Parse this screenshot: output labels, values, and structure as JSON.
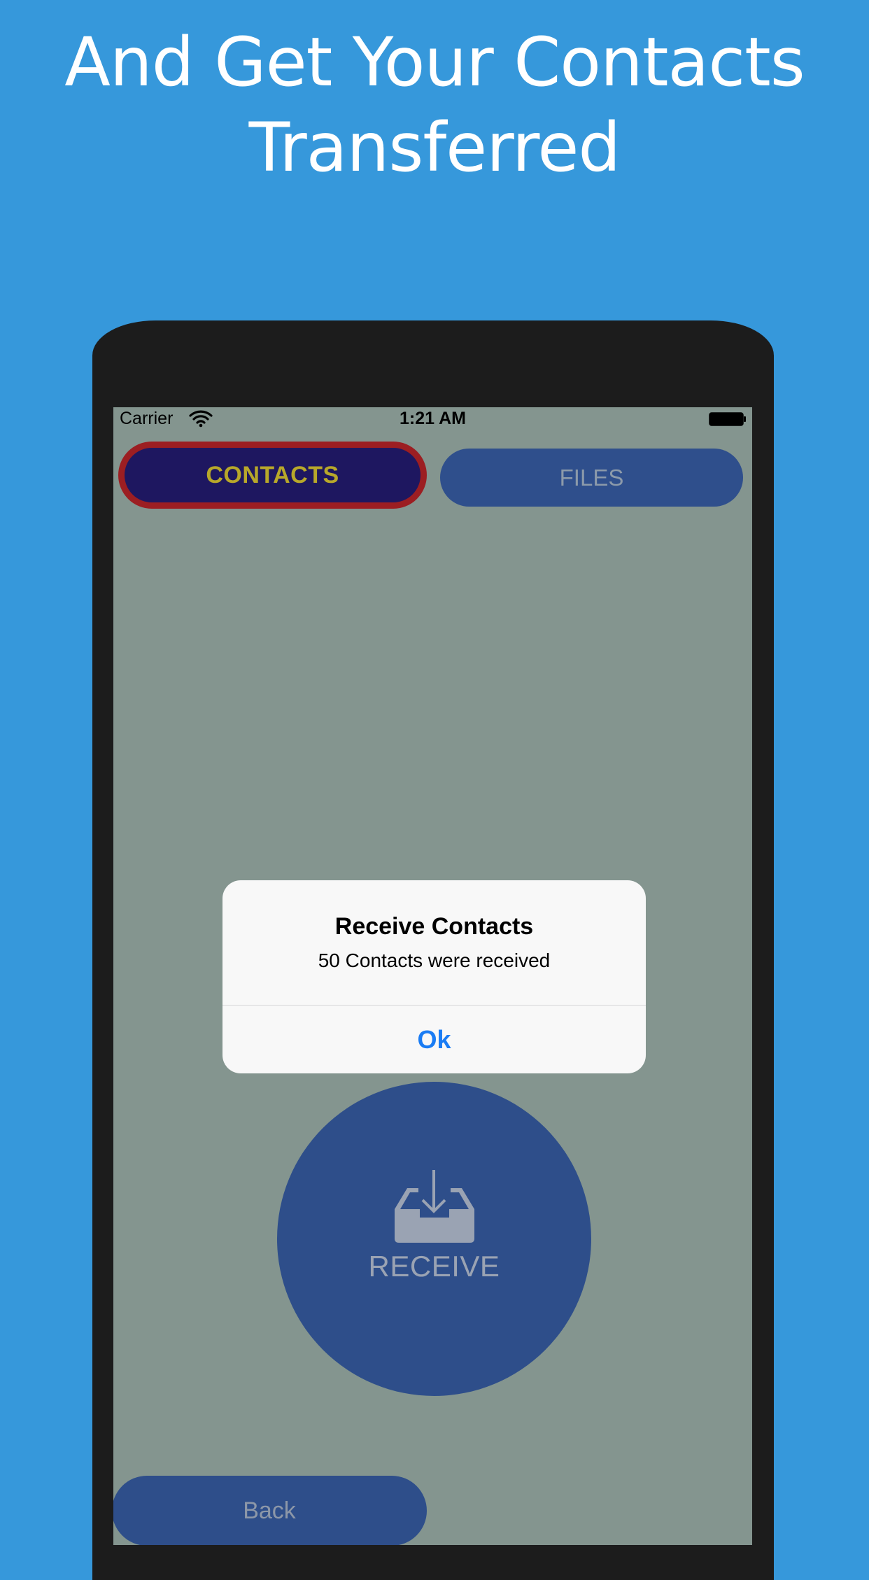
{
  "promo": {
    "headline_line1": "And Get Your Contacts",
    "headline_line2": "Transferred"
  },
  "status_bar": {
    "carrier": "Carrier",
    "time": "1:21 AM",
    "wifi_icon": "wifi-icon",
    "battery_icon": "battery-icon"
  },
  "segments": {
    "contacts_label": "CONTACTS",
    "files_label": "FILES",
    "selected": "CONTACTS"
  },
  "receive": {
    "label": "RECEIVE",
    "icon": "inbox-download-icon"
  },
  "back": {
    "label": "Back"
  },
  "alert": {
    "title": "Receive Contacts",
    "message": "50 Contacts were received",
    "ok_label": "Ok"
  },
  "colors": {
    "background": "#3698db",
    "phone_frame": "#1c1c1c",
    "screen": "#84958f",
    "contacts_tab_bg": "#1e1760",
    "contacts_tab_border": "#9c1e22",
    "contacts_tab_text": "#b8a82a",
    "button_blue": "#2e4e8a",
    "alert_action": "#1a7cf4"
  }
}
